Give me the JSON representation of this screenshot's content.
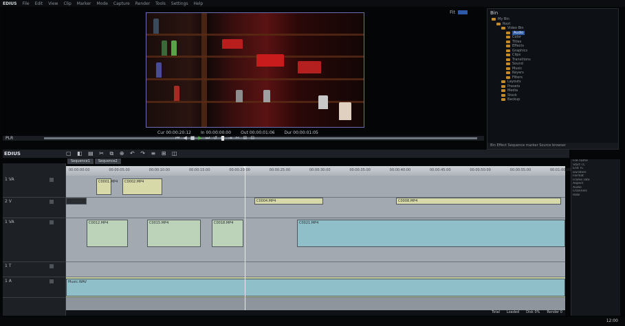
{
  "app": {
    "name": "EDIUS"
  },
  "menu": [
    "File",
    "Edit",
    "View",
    "Clip",
    "Marker",
    "Mode",
    "Capture",
    "Render",
    "Tools",
    "Settings",
    "Help"
  ],
  "player": {
    "timecodes": [
      "Cur 00:00:20:12",
      "In 00:00:00:00",
      "Out 00:00:01:06",
      "Dur 00:00:01:05"
    ],
    "scrub_label": "PLR",
    "zoom_label": "Fit",
    "playhead_fraction": 0.41
  },
  "transport": [
    "⏮",
    "◀",
    "■",
    "▶",
    "⏭",
    "↺",
    "⇤",
    "⇥",
    "✂",
    "⊞",
    "⊟"
  ],
  "library": {
    "title": "Bin",
    "items": [
      {
        "label": "My Bin",
        "indent": 0,
        "selected": false
      },
      {
        "label": "Root",
        "indent": 1,
        "selected": false
      },
      {
        "label": "Video Bin",
        "indent": 2,
        "selected": false
      },
      {
        "label": "Audio",
        "indent": 3,
        "selected": true
      },
      {
        "label": "Color",
        "indent": 3,
        "selected": false
      },
      {
        "label": "Titles",
        "indent": 3,
        "selected": false
      },
      {
        "label": "Effects",
        "indent": 3,
        "selected": false
      },
      {
        "label": "Graphics",
        "indent": 3,
        "selected": false
      },
      {
        "label": "Clips",
        "indent": 3,
        "selected": false
      },
      {
        "label": "Transitions",
        "indent": 3,
        "selected": false
      },
      {
        "label": "Sound",
        "indent": 3,
        "selected": false
      },
      {
        "label": "Music",
        "indent": 3,
        "selected": false
      },
      {
        "label": "Keyers",
        "indent": 3,
        "selected": false
      },
      {
        "label": "Filters",
        "indent": 3,
        "selected": false
      },
      {
        "label": "Layouts",
        "indent": 2,
        "selected": false
      },
      {
        "label": "Presets",
        "indent": 2,
        "selected": false
      },
      {
        "label": "Media",
        "indent": 2,
        "selected": false
      },
      {
        "label": "Stock",
        "indent": 2,
        "selected": false
      },
      {
        "label": "Backup",
        "indent": 2,
        "selected": false
      }
    ],
    "footer": "Bin  Effect  Sequence marker  Source browser"
  },
  "timeline": {
    "title": "EDIUS",
    "tabs": [
      "Sequence1",
      "Sequence2"
    ],
    "ruler": [
      "00:00:00:00",
      "00:00:05:00",
      "00:00:10:00",
      "00:00:15:00",
      "00:00:20:00",
      "00:00:25:00",
      "00:00:30:00",
      "00:00:35:00",
      "00:00:40:00",
      "00:00:45:00",
      "00:00:50:00",
      "00:00:55:00",
      "00:01:00:00"
    ],
    "tracks": [
      {
        "name": "1 VA"
      },
      {
        "name": "2 V"
      },
      {
        "name": "1 VA"
      },
      {
        "name": "1 T"
      },
      {
        "name": "1 A"
      }
    ],
    "clips": [
      {
        "label": "C0001.MP4",
        "color": "y"
      },
      {
        "label": "C0002.MP4",
        "color": "y"
      },
      {
        "label": "C0004.MP4",
        "color": "y"
      },
      {
        "label": "C0008.MP4",
        "color": "y"
      },
      {
        "label": "C0012.MP4",
        "color": "g"
      },
      {
        "label": "C0015.MP4",
        "color": "g"
      },
      {
        "label": "C0018.MP4",
        "color": "g"
      },
      {
        "label": "C0021.MP4",
        "color": "b"
      },
      {
        "label": "Music.WAV",
        "color": "b"
      }
    ]
  },
  "info_panel": [
    "File name",
    "Start TC",
    "End TC",
    "Duration",
    "Format",
    "Frame rate",
    "Aspect",
    "Audio",
    "Channels",
    "Rate"
  ],
  "status": [
    "Total",
    "Loaded",
    "Disk 0%",
    "Render 0"
  ],
  "taskbar": {
    "clock": "12:00"
  }
}
